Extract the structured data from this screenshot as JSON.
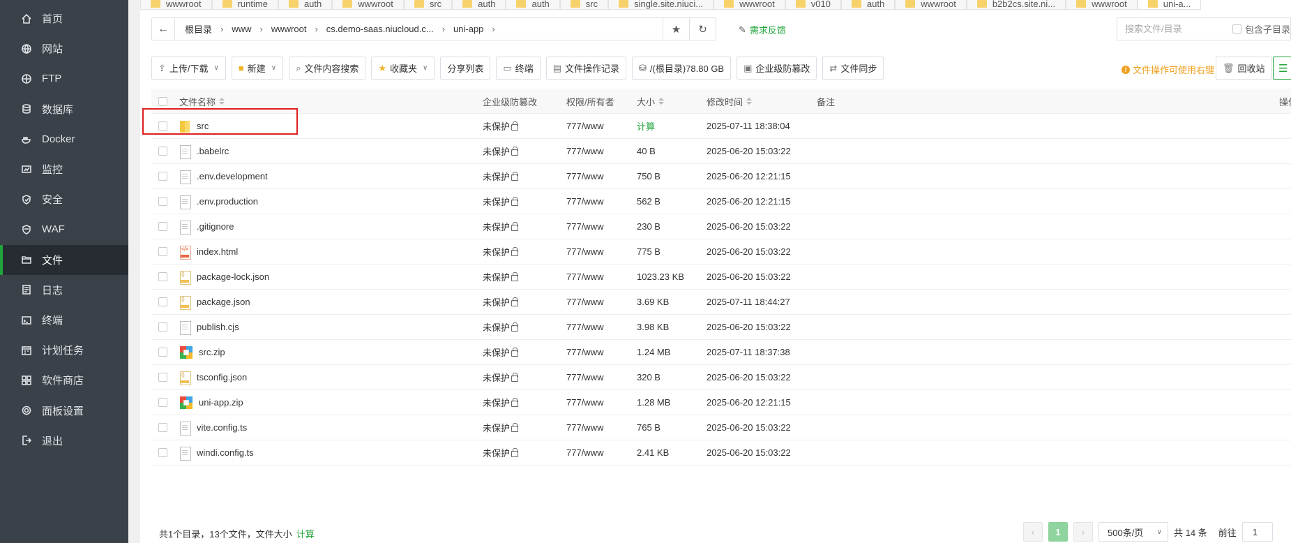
{
  "sidebar": {
    "items": [
      {
        "label": "首页",
        "icon": "home-icon"
      },
      {
        "label": "网站",
        "icon": "globe-icon"
      },
      {
        "label": "FTP",
        "icon": "ftp-icon"
      },
      {
        "label": "数据库",
        "icon": "database-icon"
      },
      {
        "label": "Docker",
        "icon": "docker-icon"
      },
      {
        "label": "监控",
        "icon": "monitor-icon"
      },
      {
        "label": "安全",
        "icon": "shield-icon"
      },
      {
        "label": "WAF",
        "icon": "waf-shield-icon"
      },
      {
        "label": "文件",
        "icon": "folder-icon"
      },
      {
        "label": "日志",
        "icon": "log-icon"
      },
      {
        "label": "终端",
        "icon": "terminal-icon"
      },
      {
        "label": "计划任务",
        "icon": "calendar-icon"
      },
      {
        "label": "软件商店",
        "icon": "apps-icon"
      },
      {
        "label": "面板设置",
        "icon": "gear-icon"
      },
      {
        "label": "退出",
        "icon": "logout-icon"
      }
    ],
    "active_index": 8,
    "accent_color": "#20a53a"
  },
  "tabs": [
    "wwwroot",
    "runtime",
    "auth",
    "wwwroot",
    "src",
    "auth",
    "auth",
    "src",
    "single.site.niuci...",
    "wwwroot",
    "v010",
    "auth",
    "wwwroot",
    "b2b2cs.site.ni...",
    "wwwroot",
    "uni-a..."
  ],
  "pathbar": {
    "crumbs": [
      "根目录",
      "www",
      "wwwroot",
      "cs.demo-saas.niucloud.c...",
      "uni-app"
    ],
    "feedback_label": "需求反馈"
  },
  "search": {
    "placeholder": "搜索文件/目录",
    "subdir_label": "包含子目录"
  },
  "toolbar": {
    "upload_label": "上传/下载",
    "new_label": "新建",
    "content_search_label": "文件内容搜索",
    "favorites_label": "收藏夹",
    "share_list_label": "分享列表",
    "terminal_label": "终端",
    "op_log_label": "文件操作记录",
    "disk_label": "/(根目录)78.80 GB",
    "tamper_label": "企业级防篡改",
    "sync_label": "文件同步",
    "hint_label": "文件操作可使用右键",
    "recycle_label": "回收站"
  },
  "table": {
    "headers": {
      "name": "文件名称",
      "protect": "企业级防篡改",
      "perm": "权限/所有者",
      "size": "大小",
      "mtime": "修改时间",
      "note": "备注",
      "ops": "操作"
    },
    "rows": [
      {
        "name": "src",
        "type": "folder",
        "protect": "未保护",
        "perm": "777/www",
        "size": "计算",
        "mtime": "2025-07-11 18:38:04"
      },
      {
        "name": ".babelrc",
        "type": "doc",
        "protect": "未保护",
        "perm": "777/www",
        "size": "40 B",
        "mtime": "2025-06-20 15:03:22"
      },
      {
        "name": ".env.development",
        "type": "doc",
        "protect": "未保护",
        "perm": "777/www",
        "size": "750 B",
        "mtime": "2025-06-20 12:21:15"
      },
      {
        "name": ".env.production",
        "type": "doc",
        "protect": "未保护",
        "perm": "777/www",
        "size": "562 B",
        "mtime": "2025-06-20 12:21:15"
      },
      {
        "name": ".gitignore",
        "type": "doc",
        "protect": "未保护",
        "perm": "777/www",
        "size": "230 B",
        "mtime": "2025-06-20 15:03:22"
      },
      {
        "name": "index.html",
        "type": "html",
        "protect": "未保护",
        "perm": "777/www",
        "size": "775 B",
        "mtime": "2025-06-20 15:03:22"
      },
      {
        "name": "package-lock.json",
        "type": "json",
        "protect": "未保护",
        "perm": "777/www",
        "size": "1023.23 KB",
        "mtime": "2025-06-20 15:03:22"
      },
      {
        "name": "package.json",
        "type": "json",
        "protect": "未保护",
        "perm": "777/www",
        "size": "3.69 KB",
        "mtime": "2025-07-11 18:44:27"
      },
      {
        "name": "publish.cjs",
        "type": "doc",
        "protect": "未保护",
        "perm": "777/www",
        "size": "3.98 KB",
        "mtime": "2025-06-20 15:03:22"
      },
      {
        "name": "src.zip",
        "type": "zip",
        "protect": "未保护",
        "perm": "777/www",
        "size": "1.24 MB",
        "mtime": "2025-07-11 18:37:38"
      },
      {
        "name": "tsconfig.json",
        "type": "json",
        "protect": "未保护",
        "perm": "777/www",
        "size": "320 B",
        "mtime": "2025-06-20 15:03:22"
      },
      {
        "name": "uni-app.zip",
        "type": "zip",
        "protect": "未保护",
        "perm": "777/www",
        "size": "1.28 MB",
        "mtime": "2025-06-20 12:21:15"
      },
      {
        "name": "vite.config.ts",
        "type": "doc",
        "protect": "未保护",
        "perm": "777/www",
        "size": "765 B",
        "mtime": "2025-06-20 15:03:22"
      },
      {
        "name": "windi.config.ts",
        "type": "doc",
        "protect": "未保护",
        "perm": "777/www",
        "size": "2.41 KB",
        "mtime": "2025-06-20 15:03:22"
      }
    ]
  },
  "footer": {
    "summary": "共1个目录，13个文件，文件大小",
    "calc_label": "计算",
    "page": "1",
    "per_page": "500条/页",
    "total": "共 14 条",
    "goto_label": "前往",
    "goto_value": "1"
  }
}
